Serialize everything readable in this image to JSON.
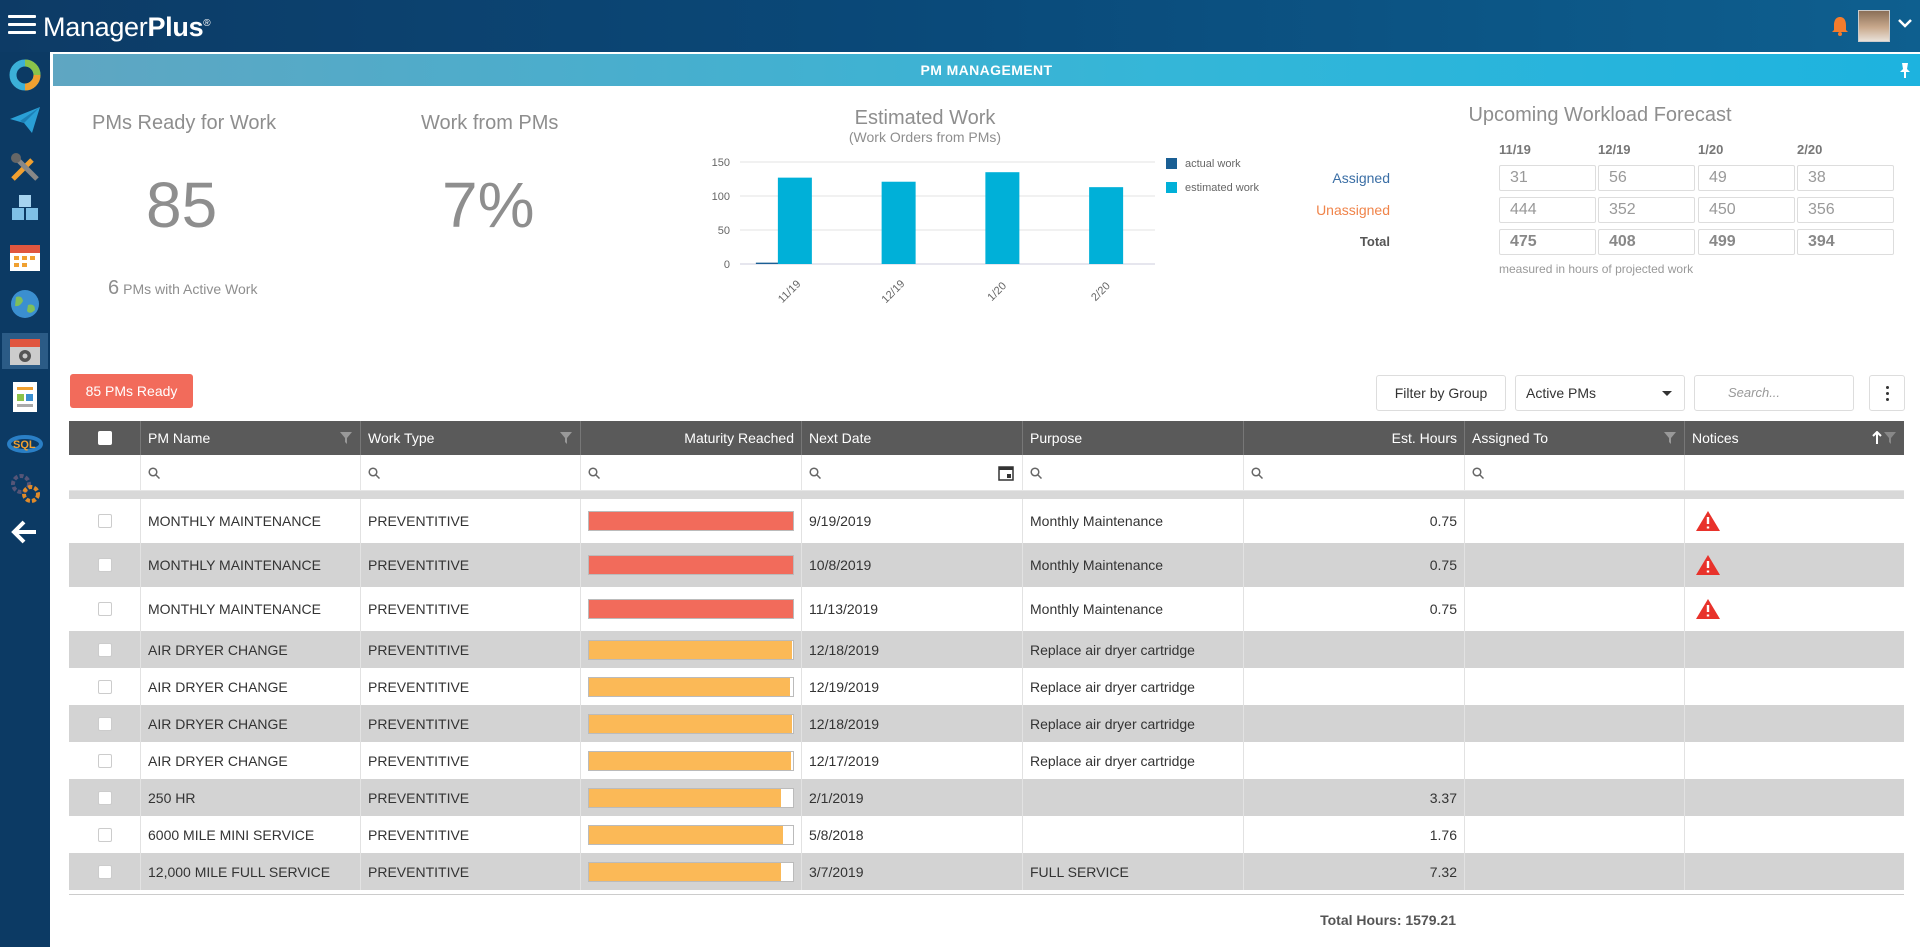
{
  "app": {
    "logo_main": "Manager",
    "logo_bold": "Plus",
    "logo_mark": "®"
  },
  "panel": {
    "title": "PM MANAGEMENT"
  },
  "kpis": {
    "ready": {
      "title": "PMs Ready for Work",
      "value": "85",
      "sub_count": "6",
      "sub_label": "PMs with Active Work"
    },
    "work": {
      "title": "Work from PMs",
      "value": "7%"
    }
  },
  "chart_data": {
    "type": "bar",
    "title": "Estimated Work",
    "subtitle": "(Work Orders from PMs)",
    "categories": [
      "11/19",
      "12/19",
      "1/20",
      "2/20"
    ],
    "series": [
      {
        "name": "actual work",
        "color": "#1a5f94",
        "values": [
          2,
          0,
          0,
          0
        ]
      },
      {
        "name": "estimated work",
        "color": "#00b0d8",
        "values": [
          127,
          121,
          135,
          113
        ]
      }
    ],
    "ylim": [
      0,
      150
    ],
    "yticks": [
      "0",
      "50",
      "100",
      "150"
    ],
    "grid": true,
    "legend": "right"
  },
  "forecast": {
    "title": "Upcoming Workload Forecast",
    "columns": [
      "11/19",
      "12/19",
      "1/20",
      "2/20"
    ],
    "rows": [
      {
        "label": "Assigned",
        "values": [
          "31",
          "56",
          "49",
          "38"
        ]
      },
      {
        "label": "Unassigned",
        "values": [
          "444",
          "352",
          "450",
          "356"
        ]
      },
      {
        "label": "Total",
        "values": [
          "475",
          "408",
          "499",
          "394"
        ]
      }
    ],
    "note": "measured in hours of projected work",
    "colors": {
      "assigned": "#3a6ea5",
      "unassigned": "#f0844a"
    }
  },
  "toolbar": {
    "ready_button": "85 PMs Ready",
    "filter_group": "Filter by Group",
    "select_value": "Active PMs",
    "search_placeholder": "Search..."
  },
  "grid": {
    "columns": [
      "PM Name",
      "Work Type",
      "Maturity Reached",
      "Next Date",
      "Purpose",
      "Est. Hours",
      "Assigned To",
      "Notices"
    ],
    "rows": [
      {
        "name": "MONTHLY MAINTENANCE",
        "type": "PREVENTITIVE",
        "maturity": 1.0,
        "status": "overdue",
        "next_date": "9/19/2019",
        "purpose": "Monthly Maintenance",
        "hours": "0.75",
        "assigned": "",
        "notice": "warning"
      },
      {
        "name": "MONTHLY MAINTENANCE",
        "type": "PREVENTITIVE",
        "maturity": 1.0,
        "status": "overdue",
        "next_date": "10/8/2019",
        "purpose": "Monthly Maintenance",
        "hours": "0.75",
        "assigned": "",
        "notice": "warning"
      },
      {
        "name": "MONTHLY MAINTENANCE",
        "type": "PREVENTITIVE",
        "maturity": 1.0,
        "status": "overdue",
        "next_date": "11/13/2019",
        "purpose": "Monthly Maintenance",
        "hours": "0.75",
        "assigned": "",
        "notice": "warning"
      },
      {
        "name": "AIR DRYER CHANGE",
        "type": "PREVENTITIVE",
        "maturity": 0.995,
        "status": "due",
        "next_date": "12/18/2019",
        "purpose": "Replace air dryer cartridge",
        "hours": "",
        "assigned": "",
        "notice": ""
      },
      {
        "name": "AIR DRYER CHANGE",
        "type": "PREVENTITIVE",
        "maturity": 0.985,
        "status": "due",
        "next_date": "12/19/2019",
        "purpose": "Replace air dryer cartridge",
        "hours": "",
        "assigned": "",
        "notice": ""
      },
      {
        "name": "AIR DRYER CHANGE",
        "type": "PREVENTITIVE",
        "maturity": 0.995,
        "status": "due",
        "next_date": "12/18/2019",
        "purpose": "Replace air dryer cartridge",
        "hours": "",
        "assigned": "",
        "notice": ""
      },
      {
        "name": "AIR DRYER CHANGE",
        "type": "PREVENTITIVE",
        "maturity": 0.99,
        "status": "due",
        "next_date": "12/17/2019",
        "purpose": "Replace air dryer cartridge",
        "hours": "",
        "assigned": "",
        "notice": ""
      },
      {
        "name": "250 HR",
        "type": "PREVENTITIVE",
        "maturity": 0.94,
        "status": "due",
        "next_date": "2/1/2019",
        "purpose": "",
        "hours": "3.37",
        "assigned": "",
        "notice": ""
      },
      {
        "name": "6000 MILE MINI SERVICE",
        "type": "PREVENTITIVE",
        "maturity": 0.95,
        "status": "due",
        "next_date": "5/8/2018",
        "purpose": "",
        "hours": "1.76",
        "assigned": "",
        "notice": ""
      },
      {
        "name": "12,000 MILE FULL SERVICE",
        "type": "PREVENTITIVE",
        "maturity": 0.94,
        "status": "due",
        "next_date": "3/7/2019",
        "purpose": "FULL SERVICE",
        "hours": "7.32",
        "assigned": "",
        "notice": ""
      }
    ],
    "total_hours": "Total Hours: 1579.21",
    "colors": {
      "overdue": "#f26b5b",
      "due": "#fbb957"
    }
  }
}
